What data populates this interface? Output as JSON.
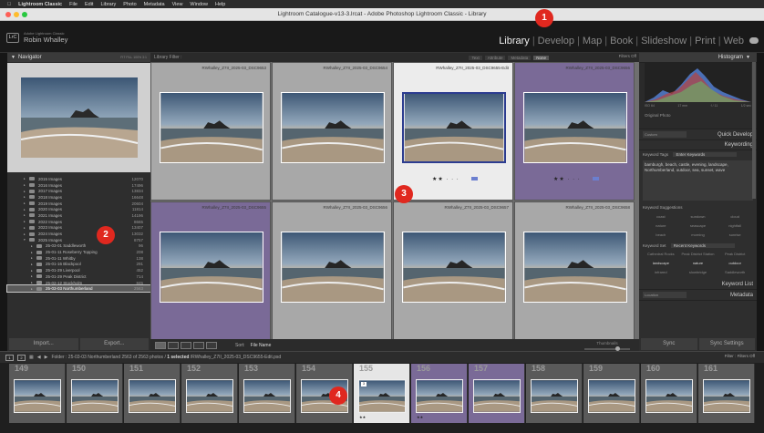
{
  "macbar": {
    "app": "Lightroom Classic",
    "menus": [
      "File",
      "Edit",
      "Library",
      "Photo",
      "Metadata",
      "View",
      "Window",
      "Help"
    ]
  },
  "window": {
    "title": "Lightroom Catalogue-v13-3.lrcat - Adobe Photoshop Lightroom Classic - Library"
  },
  "identity": {
    "badge": "LrC",
    "small": "Adobe Lightroom Classic",
    "name": "Robin Whalley"
  },
  "modules": [
    "Library",
    "Develop",
    "Map",
    "Book",
    "Slideshow",
    "Print",
    "Web"
  ],
  "navigator": {
    "title": "Navigator",
    "options": "FIT  FILL  100%  3:1"
  },
  "folders": [
    {
      "label": "2015 Images",
      "count": "12070"
    },
    {
      "label": "2016 Images",
      "count": "17496"
    },
    {
      "label": "2017 Images",
      "count": "13834"
    },
    {
      "label": "2018 Images",
      "count": "16648"
    },
    {
      "label": "2019 Images",
      "count": "20604"
    },
    {
      "label": "2020 Images",
      "count": "11814"
    },
    {
      "label": "2021 Images",
      "count": "14196"
    },
    {
      "label": "2022 Images",
      "count": "8665"
    },
    {
      "label": "2023 Images",
      "count": "13407"
    },
    {
      "label": "2024 Images",
      "count": "13032"
    },
    {
      "label": "2025 Images",
      "count": "8757"
    },
    {
      "label": "25-03-01 Saddleworth",
      "count": "96"
    },
    {
      "label": "25-01-11 Roseberry Topping",
      "count": "208"
    },
    {
      "label": "25-01-11 Whitby",
      "count": "138"
    },
    {
      "label": "25-01-16 Blackpool",
      "count": "291"
    },
    {
      "label": "25-01-29 Liverpool",
      "count": "452"
    },
    {
      "label": "25-01-29 Peak District",
      "count": "714"
    },
    {
      "label": "25-02-12 Stockholm",
      "count": "845"
    },
    {
      "label": "25-03-03 Northumberland",
      "count": "2563"
    }
  ],
  "left_buttons": {
    "import": "Import...",
    "export": "Export..."
  },
  "library_filter": {
    "title": "Library Filter :",
    "options": [
      "Text",
      "Attribute",
      "Metadata",
      "None"
    ],
    "filters_off": "Filters Off"
  },
  "grid": [
    {
      "name": "RWhalley_Z7II_2025-03_DSC9653",
      "stars": ""
    },
    {
      "name": "RWhalley_Z7II_2025-03_DSC9654",
      "stars": ""
    },
    {
      "name": "RWhalley_Z7II_2025-03_DSC9655-Edit",
      "stars": "★★ · · ·"
    },
    {
      "name": "RWhalley_Z7II_2025-03_DSC9656",
      "stars": "★★ · · ·"
    },
    {
      "name": "RWhalley_Z7II_2025-03_DSC9655",
      "stars": ""
    },
    {
      "name": "RWhalley_Z7II_2025-03_DSC9656",
      "stars": ""
    },
    {
      "name": "RWhalley_Z7II_2025-03_DSC9657",
      "stars": ""
    },
    {
      "name": "RWhalley_Z7II_2025-03_DSC9658",
      "stars": ""
    }
  ],
  "toolbar": {
    "sort_label": "Sort:",
    "sort_value": "File Name",
    "thumbnails": "Thumbnails"
  },
  "histogram": {
    "title": "Histogram",
    "labels": [
      "ISO 64",
      "17 mm",
      "f / 11",
      "1/2 sec"
    ],
    "original": "Original Photo"
  },
  "quick_develop": {
    "preset": "Custom",
    "label": "Quick Develop"
  },
  "keywording": {
    "title": "Keywording",
    "tags_label": "Keyword Tags",
    "tags_select": "Enter Keywords",
    "keywords": "bamburgh, beach, castle, evening, landscape, Northumberland, outdoor, sea, sunset, wave",
    "suggestions_title": "Keyword Suggestions",
    "suggestions": [
      "coast",
      "sundown",
      "cloud",
      "nature",
      "seascape",
      "nightfall",
      "beach",
      "morning",
      "sunrise"
    ],
    "set_label": "Keyword Set",
    "set_select": "Recent Keywords",
    "set": [
      "Cathedral Rocks",
      "Peak District Station",
      "Peak District",
      "landscape",
      "nature",
      "outdoor",
      "infrared",
      "slowbridge",
      "Saddleworth"
    ]
  },
  "keyword_list": "Keyword List",
  "metadata": {
    "preset": "Location",
    "title": "Metadata"
  },
  "right_buttons": {
    "sync": "Sync",
    "sync_settings": "Sync Settings"
  },
  "filmstrip_bar": {
    "pages": [
      "1",
      "2"
    ],
    "folder": "Folder : 25-03-03 Northumberland",
    "count": "2563 of 2563 photos /",
    "selected": "1 selected",
    "file": "/RWhalley_Z7II_2025-03_DSC9655-Edit.psd",
    "filter_label": "Filter :",
    "filter_value": "Filters Off"
  },
  "filmstrip": [
    "149",
    "150",
    "151",
    "152",
    "153",
    "154",
    "155",
    "156",
    "157",
    "158",
    "159",
    "160",
    "161"
  ],
  "markers": [
    "1",
    "2",
    "3",
    "4"
  ]
}
